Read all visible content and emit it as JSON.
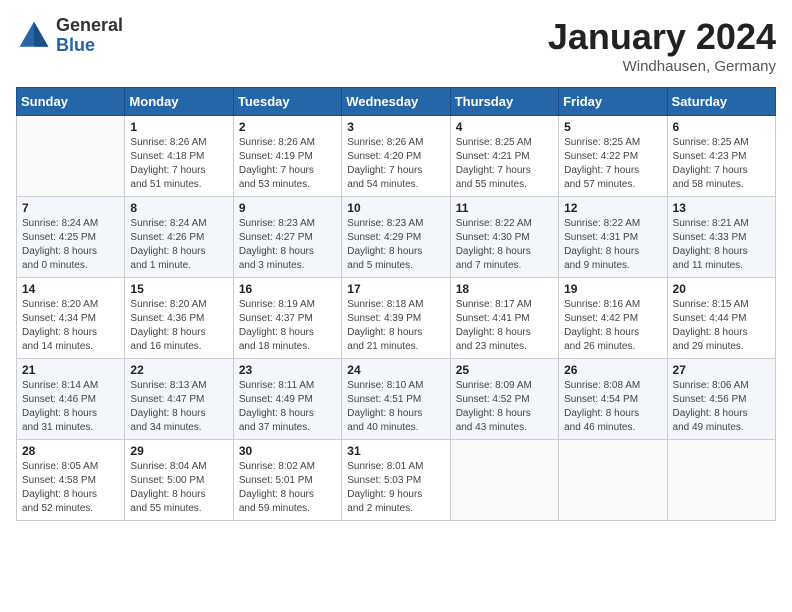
{
  "header": {
    "logo_general": "General",
    "logo_blue": "Blue",
    "month_title": "January 2024",
    "location": "Windhausen, Germany"
  },
  "weekdays": [
    "Sunday",
    "Monday",
    "Tuesday",
    "Wednesday",
    "Thursday",
    "Friday",
    "Saturday"
  ],
  "weeks": [
    [
      {
        "day": "",
        "info": ""
      },
      {
        "day": "1",
        "info": "Sunrise: 8:26 AM\nSunset: 4:18 PM\nDaylight: 7 hours\nand 51 minutes."
      },
      {
        "day": "2",
        "info": "Sunrise: 8:26 AM\nSunset: 4:19 PM\nDaylight: 7 hours\nand 53 minutes."
      },
      {
        "day": "3",
        "info": "Sunrise: 8:26 AM\nSunset: 4:20 PM\nDaylight: 7 hours\nand 54 minutes."
      },
      {
        "day": "4",
        "info": "Sunrise: 8:25 AM\nSunset: 4:21 PM\nDaylight: 7 hours\nand 55 minutes."
      },
      {
        "day": "5",
        "info": "Sunrise: 8:25 AM\nSunset: 4:22 PM\nDaylight: 7 hours\nand 57 minutes."
      },
      {
        "day": "6",
        "info": "Sunrise: 8:25 AM\nSunset: 4:23 PM\nDaylight: 7 hours\nand 58 minutes."
      }
    ],
    [
      {
        "day": "7",
        "info": "Sunrise: 8:24 AM\nSunset: 4:25 PM\nDaylight: 8 hours\nand 0 minutes."
      },
      {
        "day": "8",
        "info": "Sunrise: 8:24 AM\nSunset: 4:26 PM\nDaylight: 8 hours\nand 1 minute."
      },
      {
        "day": "9",
        "info": "Sunrise: 8:23 AM\nSunset: 4:27 PM\nDaylight: 8 hours\nand 3 minutes."
      },
      {
        "day": "10",
        "info": "Sunrise: 8:23 AM\nSunset: 4:29 PM\nDaylight: 8 hours\nand 5 minutes."
      },
      {
        "day": "11",
        "info": "Sunrise: 8:22 AM\nSunset: 4:30 PM\nDaylight: 8 hours\nand 7 minutes."
      },
      {
        "day": "12",
        "info": "Sunrise: 8:22 AM\nSunset: 4:31 PM\nDaylight: 8 hours\nand 9 minutes."
      },
      {
        "day": "13",
        "info": "Sunrise: 8:21 AM\nSunset: 4:33 PM\nDaylight: 8 hours\nand 11 minutes."
      }
    ],
    [
      {
        "day": "14",
        "info": "Sunrise: 8:20 AM\nSunset: 4:34 PM\nDaylight: 8 hours\nand 14 minutes."
      },
      {
        "day": "15",
        "info": "Sunrise: 8:20 AM\nSunset: 4:36 PM\nDaylight: 8 hours\nand 16 minutes."
      },
      {
        "day": "16",
        "info": "Sunrise: 8:19 AM\nSunset: 4:37 PM\nDaylight: 8 hours\nand 18 minutes."
      },
      {
        "day": "17",
        "info": "Sunrise: 8:18 AM\nSunset: 4:39 PM\nDaylight: 8 hours\nand 21 minutes."
      },
      {
        "day": "18",
        "info": "Sunrise: 8:17 AM\nSunset: 4:41 PM\nDaylight: 8 hours\nand 23 minutes."
      },
      {
        "day": "19",
        "info": "Sunrise: 8:16 AM\nSunset: 4:42 PM\nDaylight: 8 hours\nand 26 minutes."
      },
      {
        "day": "20",
        "info": "Sunrise: 8:15 AM\nSunset: 4:44 PM\nDaylight: 8 hours\nand 29 minutes."
      }
    ],
    [
      {
        "day": "21",
        "info": "Sunrise: 8:14 AM\nSunset: 4:46 PM\nDaylight: 8 hours\nand 31 minutes."
      },
      {
        "day": "22",
        "info": "Sunrise: 8:13 AM\nSunset: 4:47 PM\nDaylight: 8 hours\nand 34 minutes."
      },
      {
        "day": "23",
        "info": "Sunrise: 8:11 AM\nSunset: 4:49 PM\nDaylight: 8 hours\nand 37 minutes."
      },
      {
        "day": "24",
        "info": "Sunrise: 8:10 AM\nSunset: 4:51 PM\nDaylight: 8 hours\nand 40 minutes."
      },
      {
        "day": "25",
        "info": "Sunrise: 8:09 AM\nSunset: 4:52 PM\nDaylight: 8 hours\nand 43 minutes."
      },
      {
        "day": "26",
        "info": "Sunrise: 8:08 AM\nSunset: 4:54 PM\nDaylight: 8 hours\nand 46 minutes."
      },
      {
        "day": "27",
        "info": "Sunrise: 8:06 AM\nSunset: 4:56 PM\nDaylight: 8 hours\nand 49 minutes."
      }
    ],
    [
      {
        "day": "28",
        "info": "Sunrise: 8:05 AM\nSunset: 4:58 PM\nDaylight: 8 hours\nand 52 minutes."
      },
      {
        "day": "29",
        "info": "Sunrise: 8:04 AM\nSunset: 5:00 PM\nDaylight: 8 hours\nand 55 minutes."
      },
      {
        "day": "30",
        "info": "Sunrise: 8:02 AM\nSunset: 5:01 PM\nDaylight: 8 hours\nand 59 minutes."
      },
      {
        "day": "31",
        "info": "Sunrise: 8:01 AM\nSunset: 5:03 PM\nDaylight: 9 hours\nand 2 minutes."
      },
      {
        "day": "",
        "info": ""
      },
      {
        "day": "",
        "info": ""
      },
      {
        "day": "",
        "info": ""
      }
    ]
  ]
}
